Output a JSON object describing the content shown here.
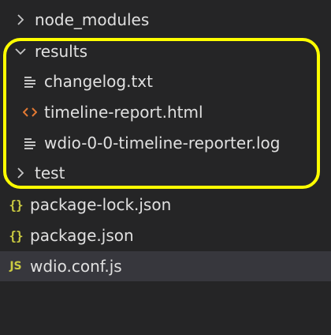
{
  "explorer": {
    "items": [
      {
        "label": "node_modules",
        "icon": "chevron-right-icon"
      },
      {
        "label": "results",
        "icon": "chevron-down-icon"
      },
      {
        "label": "changelog.txt",
        "icon": "text-file-icon"
      },
      {
        "label": "timeline-report.html",
        "icon": "html-file-icon"
      },
      {
        "label": "wdio-0-0-timeline-reporter.log",
        "icon": "text-file-icon"
      },
      {
        "label": "test",
        "icon": "chevron-right-icon"
      },
      {
        "label": "package-lock.json",
        "icon": "json-file-icon",
        "glyph": "{}"
      },
      {
        "label": "package.json",
        "icon": "json-file-icon",
        "glyph": "{}"
      },
      {
        "label": "wdio.conf.js",
        "icon": "js-file-icon",
        "glyph": "JS",
        "selected": true
      }
    ]
  },
  "colors": {
    "background": "#252526",
    "selected_row": "#37373d",
    "highlight": "#ffff00",
    "json_icon": "#cbcb41",
    "html_icon": "#e37933",
    "text_icon": "#c5c5c5"
  }
}
